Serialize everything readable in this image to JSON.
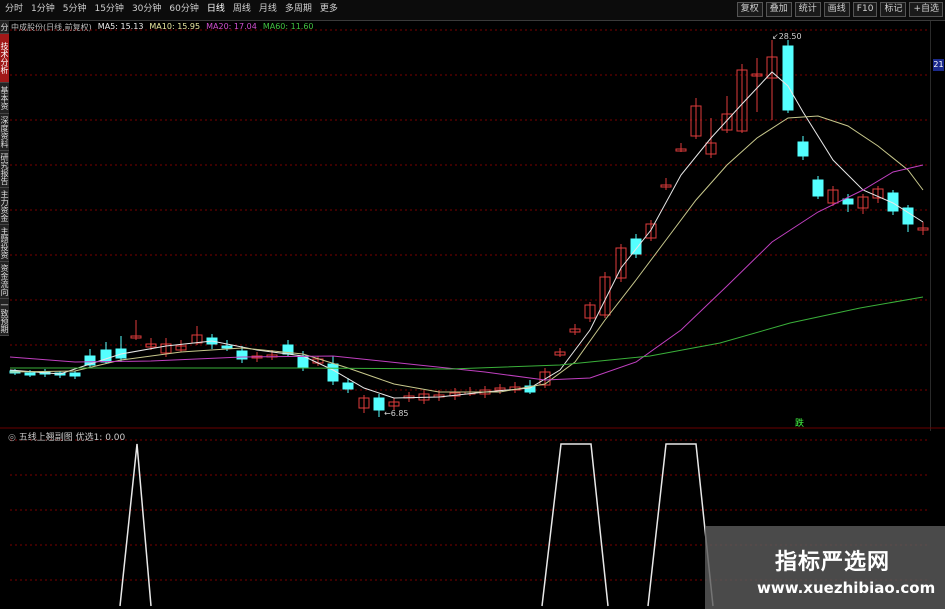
{
  "toolbar": {
    "periods": [
      "分时",
      "1分钟",
      "5分钟",
      "15分钟",
      "30分钟",
      "60分钟",
      "日线",
      "周线",
      "月线",
      "多周期",
      "更多"
    ],
    "active_period": "日线",
    "right_buttons": [
      "复权",
      "叠加",
      "统计",
      "画线",
      "F10",
      "标记",
      "+自选"
    ]
  },
  "sidebar": {
    "tabs": [
      "分时走势",
      "技术分析",
      "基本资料",
      "深度资料",
      "研究报告",
      "主力资金",
      "主题投资",
      "资金流向",
      "一致预期"
    ],
    "active_index": 1
  },
  "legend": {
    "stock": "中成股份(日线,前复权)",
    "ma5": "MA5: 15.13",
    "ma10": "MA10: 15.95",
    "ma20": "MA20: 17.04",
    "ma60": "MA60: 11.60"
  },
  "right_badge": "21",
  "price_labels": {
    "high": "28.50",
    "low": "6.85"
  },
  "signal_glyph": "跌",
  "indicator_title": "五线上翘副图 优选1: 0.00",
  "watermark": {
    "cn": "指标严选网",
    "en": "www.xuezhibiao.com"
  },
  "colors": {
    "up": "#e03c3c",
    "down": "#54ffff",
    "ma5": "#e8e8e8",
    "ma10": "#c8c88c",
    "ma20": "#c040c0",
    "ma60": "#3ab03a",
    "indicator": "#e8e8e8",
    "grid": "#7a0000"
  }
}
